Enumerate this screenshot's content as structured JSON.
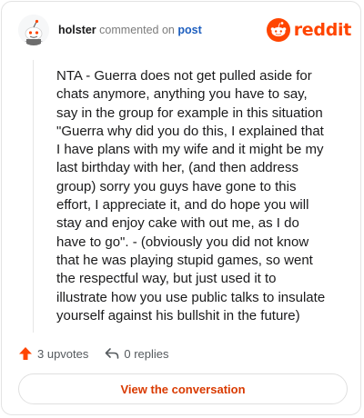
{
  "header": {
    "username": "holster",
    "action_text": "commented on",
    "post_link": "post",
    "brand": "reddit",
    "avatar_icon": "snoo-avatar-icon",
    "brand_icon": "reddit-snoo-icon"
  },
  "comment": {
    "text": "NTA - Guerra does not get pulled aside for chats anymore, anything you have to say, say in the group for example in this situation \"Guerra why did you do this, I explained that I have plans with my wife and it might be my last birthday with her, (and then address group) sorry you guys have gone to this effort, I appreciate it, and do hope you will stay and enjoy cake with out me, as I do have to go\". - (obviously you did not know that he was playing stupid games, so went the respectful way, but just used it to illustrate how you use public talks to insulate yourself against his bullshit in the future)"
  },
  "actions": {
    "upvotes_label": "3 upvotes",
    "replies_label": "0 replies",
    "upvote_icon": "upvote-arrow-icon",
    "reply_icon": "reply-arrow-icon"
  },
  "footer": {
    "view_label": "View the conversation"
  },
  "colors": {
    "brand": "#ff4500",
    "link": "#1e5fbf",
    "cta": "#d93a00"
  }
}
